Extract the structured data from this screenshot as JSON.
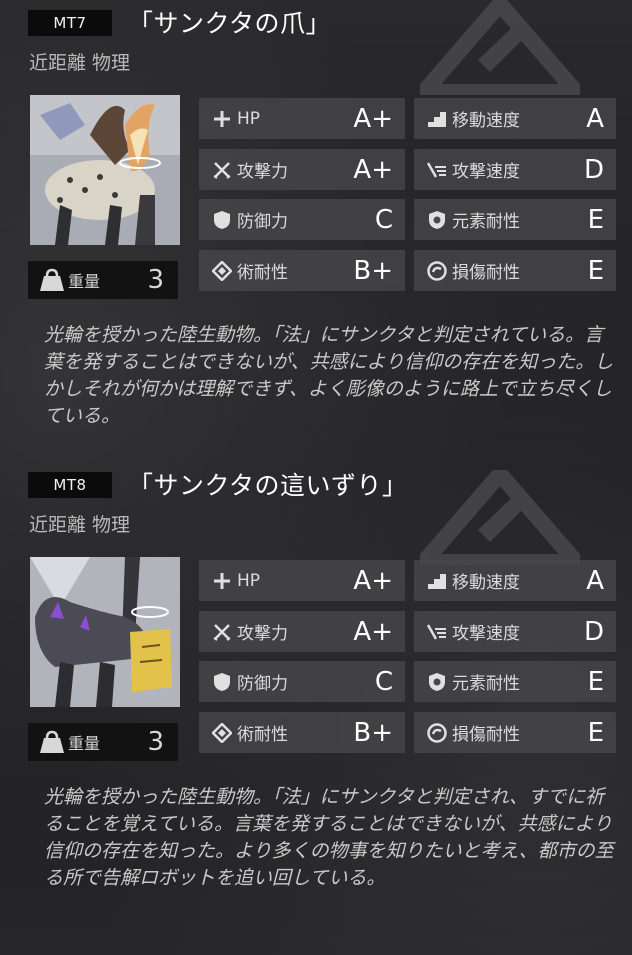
{
  "entries": [
    {
      "code": "MT7",
      "name": "「サンクタの爪」",
      "subtitle": "近距離 物理",
      "weight": {
        "label": "重量",
        "value": "3"
      },
      "stats_left": [
        {
          "icon": "plus-icon",
          "label": "HP",
          "grade": "A+"
        },
        {
          "icon": "crossed-swords-icon",
          "label": "攻撃力",
          "grade": "A+"
        },
        {
          "icon": "shield-icon",
          "label": "防御力",
          "grade": "C"
        },
        {
          "icon": "diamond-rune-icon",
          "label": "術耐性",
          "grade": "B+"
        }
      ],
      "stats_right": [
        {
          "icon": "stairs-icon",
          "label": "移動速度",
          "grade": "A"
        },
        {
          "icon": "speed-lines-icon",
          "label": "攻撃速度",
          "grade": "D"
        },
        {
          "icon": "element-shield-icon",
          "label": "元素耐性",
          "grade": "E"
        },
        {
          "icon": "swirl-icon",
          "label": "損傷耐性",
          "grade": "E"
        }
      ],
      "description": "光輪を授かった陸生動物。「法」にサンクタと判定されている。言葉を発することはできないが、共感により信仰の存在を知った。しかしそれが何かは理解できず、よく彫像のように路上で立ち尽くしている。"
    },
    {
      "code": "MT8",
      "name": "「サンクタの這いずり」",
      "subtitle": "近距離 物理",
      "weight": {
        "label": "重量",
        "value": "3"
      },
      "stats_left": [
        {
          "icon": "plus-icon",
          "label": "HP",
          "grade": "A+"
        },
        {
          "icon": "crossed-swords-icon",
          "label": "攻撃力",
          "grade": "A+"
        },
        {
          "icon": "shield-icon",
          "label": "防御力",
          "grade": "C"
        },
        {
          "icon": "diamond-rune-icon",
          "label": "術耐性",
          "grade": "B+"
        }
      ],
      "stats_right": [
        {
          "icon": "stairs-icon",
          "label": "移動速度",
          "grade": "A"
        },
        {
          "icon": "speed-lines-icon",
          "label": "攻撃速度",
          "grade": "D"
        },
        {
          "icon": "element-shield-icon",
          "label": "元素耐性",
          "grade": "E"
        },
        {
          "icon": "swirl-icon",
          "label": "損傷耐性",
          "grade": "E"
        }
      ],
      "description": "光輪を授かった陸生動物。「法」にサンクタと判定され、すでに祈ることを覚えている。言葉を発することはできないが、共感により信仰の存在を知った。より多くの物事を知りたいと考え、都市の至る所で告解ロボットを追い回している。"
    }
  ]
}
